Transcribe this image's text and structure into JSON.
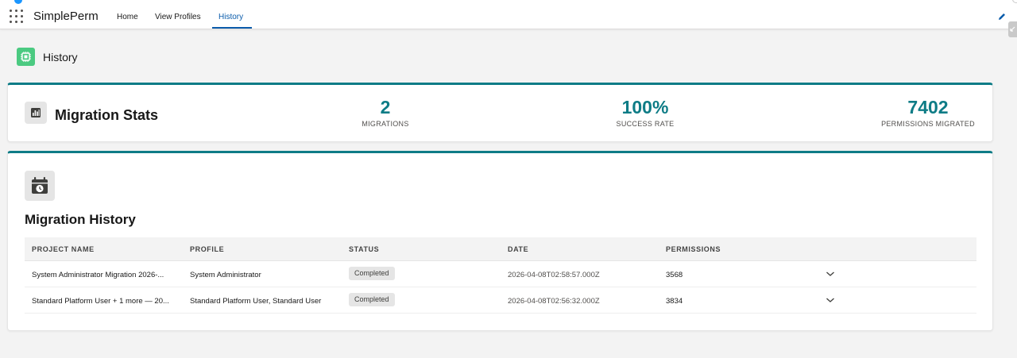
{
  "nav": {
    "app_name": "SimplePerm",
    "tabs": [
      {
        "label": "Home",
        "active": false
      },
      {
        "label": "View Profiles",
        "active": false
      },
      {
        "label": "History",
        "active": true
      }
    ]
  },
  "page": {
    "title": "History",
    "icon": "chip-icon"
  },
  "stats": {
    "title": "Migration Stats",
    "icon": "bar-chart-icon",
    "items": [
      {
        "value": "2",
        "label": "MIGRATIONS"
      },
      {
        "value": "100%",
        "label": "SUCCESS RATE"
      },
      {
        "value": "7402",
        "label": "PERMISSIONS MIGRATED"
      }
    ]
  },
  "history": {
    "title": "Migration History",
    "icon": "calendar-clock-icon",
    "columns": [
      "PROJECT NAME",
      "PROFILE",
      "STATUS",
      "DATE",
      "PERMISSIONS"
    ],
    "rows": [
      {
        "project": "System Administrator Migration 2026-...",
        "profile": "System Administrator",
        "status": "Completed",
        "date": "2026-04-08T02:58:57.000Z",
        "permissions": "3568"
      },
      {
        "project": "Standard Platform User + 1 more — 20...",
        "profile": "Standard Platform User, Standard User",
        "status": "Completed",
        "date": "2026-04-08T02:56:32.000Z",
        "permissions": "3834"
      }
    ]
  },
  "colors": {
    "accent": "#0e7c86",
    "nav_active": "#0b5cab",
    "page_icon_bg": "#4bca81"
  }
}
